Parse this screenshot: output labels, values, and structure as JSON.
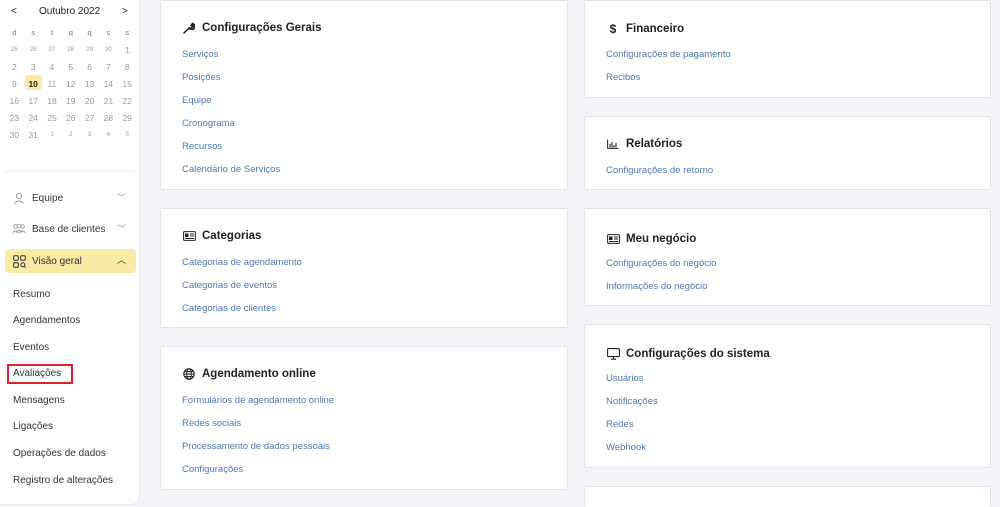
{
  "calendar": {
    "prev": "<",
    "next": ">",
    "title": "Outubro 2022",
    "dow": [
      "d",
      "s",
      "t",
      "q",
      "q",
      "s",
      "s"
    ],
    "weeks": [
      [
        "25",
        "26",
        "27",
        "28",
        "29",
        "30",
        "1"
      ],
      [
        "2",
        "3",
        "4",
        "5",
        "6",
        "7",
        "8"
      ],
      [
        "9",
        "10",
        "11",
        "12",
        "13",
        "14",
        "15"
      ],
      [
        "16",
        "17",
        "18",
        "19",
        "20",
        "21",
        "22"
      ],
      [
        "23",
        "24",
        "25",
        "26",
        "27",
        "28",
        "29"
      ],
      [
        "30",
        "31",
        "1",
        "2",
        "3",
        "4",
        "5"
      ]
    ],
    "selected": "10"
  },
  "sidebar": {
    "team": "Equipe",
    "clients": "Base de clientes",
    "overview": "Visão geral",
    "sub": [
      "Resumo",
      "Agendamentos",
      "Eventos",
      "Avaliações",
      "Mensagens",
      "Ligações",
      "Operações de dados",
      "Registro de alterações"
    ]
  },
  "cards": {
    "general": {
      "title": "Configurações Gerais",
      "links": [
        "Serviços",
        "Posições",
        "Equipe",
        "Cronograma",
        "Recursos",
        "Calendário de Serviços"
      ]
    },
    "categories": {
      "title": "Categorias",
      "links": [
        "Categorias de agendamento",
        "Categorias de eventos",
        "Categorias de clientes"
      ]
    },
    "online": {
      "title": "Agendamento online",
      "links": [
        "Formulários de agendamento online",
        "Redes sociais",
        "Processamento de dados pessoais",
        "Configurações"
      ]
    },
    "financial": {
      "title": "Financeiro",
      "links": [
        "Configurações de pagamento",
        "Recibos"
      ]
    },
    "reports": {
      "title": "Relatórios",
      "links": [
        "Configurações de retorno"
      ]
    },
    "business": {
      "title": "Meu negócio",
      "links": [
        "Configurações do negócio",
        "Informações do negócio"
      ]
    },
    "system": {
      "title": "Configurações do sistema",
      "links": [
        "Usuários",
        "Notificações",
        "Redes",
        "Webhook"
      ]
    }
  }
}
